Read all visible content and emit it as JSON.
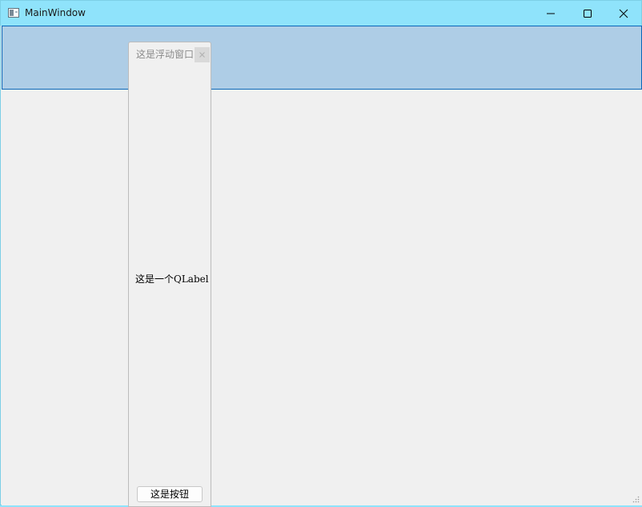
{
  "window": {
    "title": "MainWindow",
    "controls": {
      "minimize": "minimize-icon",
      "maximize": "maximize-icon",
      "close": "close-icon"
    }
  },
  "dock_widget": {
    "title": "这是浮动窗口",
    "close_icon": "close-icon",
    "label_text": "这是一个QLabel",
    "button_label": "这是按钮"
  },
  "colors": {
    "titlebar": "#8fe3fb",
    "toolbar_area": "#aecde6",
    "toolbar_border": "#0a67b8",
    "client": "#f0f0f0"
  }
}
